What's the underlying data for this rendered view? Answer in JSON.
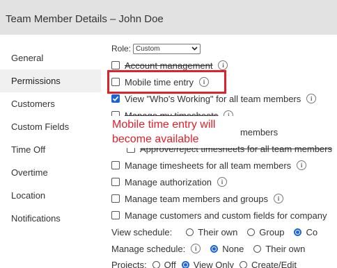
{
  "header": {
    "title": "Team Member Details – John Doe"
  },
  "nav": {
    "items": [
      {
        "label": "General"
      },
      {
        "label": "Permissions"
      },
      {
        "label": "Customers"
      },
      {
        "label": "Custom Fields"
      },
      {
        "label": "Time Off"
      },
      {
        "label": "Overtime"
      },
      {
        "label": "Location"
      },
      {
        "label": "Notifications"
      }
    ]
  },
  "role": {
    "label": "Role:",
    "value": "Custom"
  },
  "permissions": [
    {
      "label": "Account management",
      "checked": false
    },
    {
      "label": "Mobile time entry",
      "checked": false
    },
    {
      "label": "View \"Who's Working\" for all team members",
      "checked": true
    },
    {
      "label": "Manage my timesheets",
      "checked": false
    },
    {
      "label": "View timesheets for all team members",
      "checked": false
    },
    {
      "label": "Approve/reject timesheets for all team members",
      "checked": false
    },
    {
      "label": "Manage timesheets for all team members",
      "checked": false
    },
    {
      "label": "Manage authorization",
      "checked": false
    },
    {
      "label": "Manage team members and groups",
      "checked": false
    },
    {
      "label": "Manage customers and custom fields for company",
      "checked": false
    }
  ],
  "view_schedule": {
    "label": "View schedule:",
    "options": [
      "Their own",
      "Group",
      "Co"
    ],
    "selected": "Co"
  },
  "manage_schedule": {
    "label": "Manage schedule:",
    "options": [
      "None",
      "Their own"
    ],
    "selected": "None"
  },
  "projects": {
    "label": "Projects:",
    "options": [
      "Off",
      "View Only",
      "Create/Edit"
    ],
    "selected": "View Only"
  },
  "annotation": {
    "text": "Mobile time entry will become available"
  },
  "colors": {
    "accent": "#1a63d8",
    "annotation": "#e0202a",
    "header_bg": "#e2e2e2"
  }
}
